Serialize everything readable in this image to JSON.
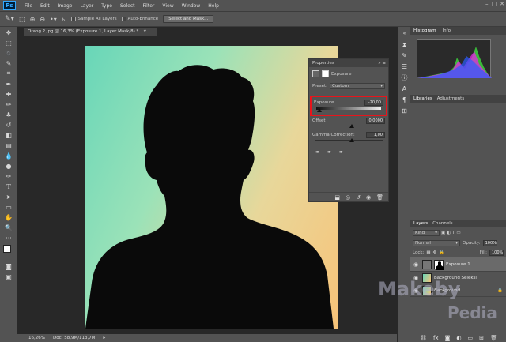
{
  "app": {
    "logo": "Ps"
  },
  "menu": [
    "File",
    "Edit",
    "Image",
    "Layer",
    "Type",
    "Select",
    "Filter",
    "View",
    "Window",
    "Help"
  ],
  "options": {
    "sample_all_layers": "Sample All Layers",
    "auto_enhance": "Auto-Enhance",
    "select_and_mask": "Select and Mask..."
  },
  "document": {
    "tab_title": "Orang 2.jpg @ 16,3% (Exposure 1, Layer Mask/8) *",
    "close": "×"
  },
  "status": {
    "zoom": "16,26%",
    "doc": "Doc: 58,9M/113,7M"
  },
  "properties": {
    "title": "Properties",
    "layer_label": "Exposure",
    "preset_label": "Preset:",
    "preset_value": "Custom",
    "exposure_label": "Exposure",
    "exposure_value": "-20,00",
    "offset_label": "Offset",
    "offset_value": "0,0000",
    "gamma_label": "Gamma Correction:",
    "gamma_value": "1,00"
  },
  "histogram": {
    "tabs": [
      "Histogram",
      "Info"
    ]
  },
  "libraries": {
    "tabs": [
      "Libraries",
      "Adjustments"
    ]
  },
  "layers_panel": {
    "tabs": [
      "Layers",
      "Channels"
    ],
    "kind": "Kind",
    "blend_mode": "Normal",
    "opacity_label": "Opacity:",
    "opacity_value": "100%",
    "lock_label": "Lock:",
    "fill_label": "Fill:",
    "fill_value": "100%",
    "layers": [
      {
        "name": "Exposure 1"
      },
      {
        "name": "Background Seleksi"
      },
      {
        "name": "Background"
      }
    ]
  },
  "watermark": {
    "line1": "Makeby",
    "line2": "Pedia"
  },
  "colors": {
    "highlight": "#e8141b",
    "panel": "#535353"
  }
}
